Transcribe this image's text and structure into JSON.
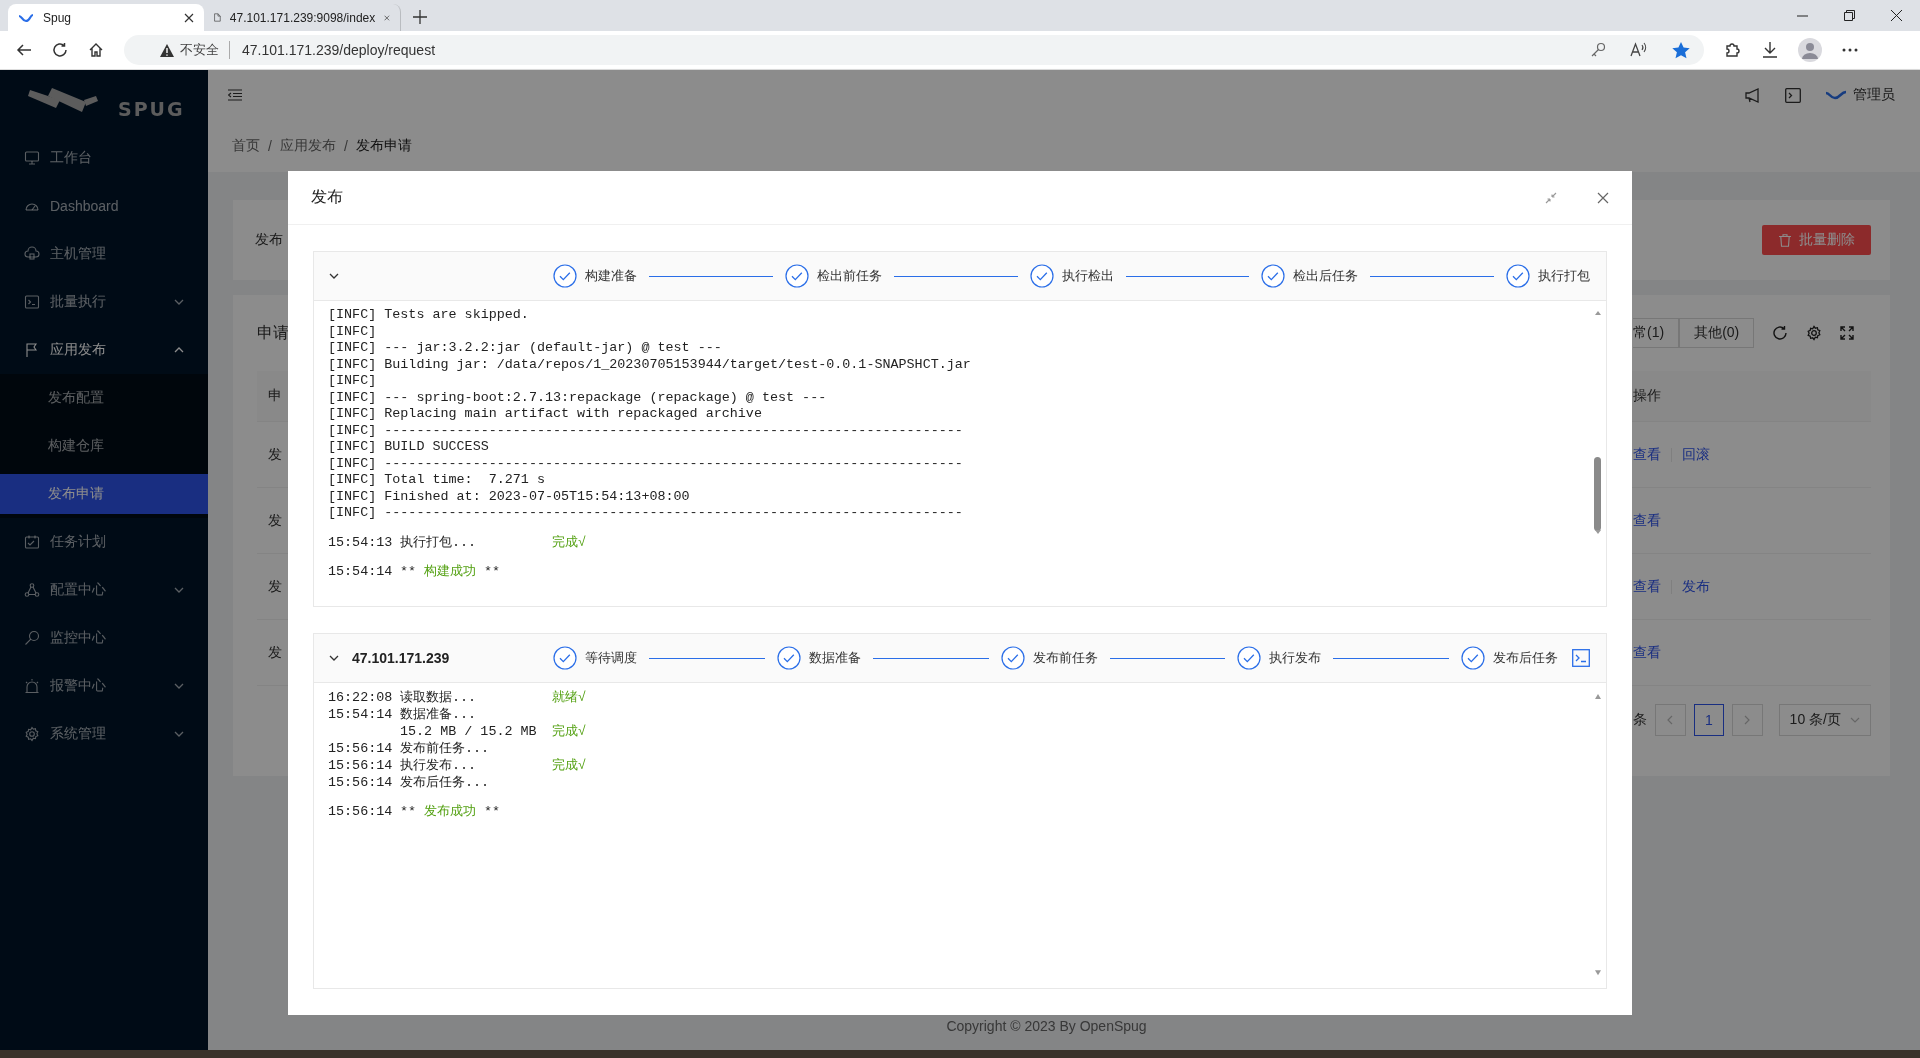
{
  "browser": {
    "tabs": [
      {
        "title": "Spug",
        "selected": true
      },
      {
        "title": "47.101.171.239:9098/index",
        "selected": false
      }
    ],
    "security": "不安全",
    "url": "47.101.171.239/deploy/request"
  },
  "sidebar": {
    "logo_text": "SPUG",
    "items": [
      {
        "label": "工作台",
        "kind": "link",
        "selected": false
      },
      {
        "label": "Dashboard",
        "kind": "link",
        "selected": false
      },
      {
        "label": "主机管理",
        "kind": "link",
        "selected": false
      },
      {
        "label": "批量执行",
        "kind": "group",
        "expanded": false,
        "selected": false
      },
      {
        "label": "应用发布",
        "kind": "group",
        "expanded": true,
        "selected": false,
        "children": [
          {
            "label": "发布配置",
            "selected": false
          },
          {
            "label": "构建仓库",
            "selected": false
          },
          {
            "label": "发布申请",
            "selected": true
          }
        ]
      },
      {
        "label": "任务计划",
        "kind": "link",
        "selected": false
      },
      {
        "label": "配置中心",
        "kind": "group",
        "expanded": false,
        "selected": false
      },
      {
        "label": "监控中心",
        "kind": "link",
        "selected": false
      },
      {
        "label": "报警中心",
        "kind": "group",
        "expanded": false,
        "selected": false
      },
      {
        "label": "系统管理",
        "kind": "group",
        "expanded": false,
        "selected": false
      }
    ]
  },
  "header": {
    "user": "管理员",
    "breadcrumb_separator": "/",
    "breadcrumb": [
      "首页",
      "应用发布",
      "发布申请"
    ]
  },
  "page": {
    "card_label": "发布",
    "batch_delete": "批量删除",
    "list_title": "申请",
    "filter_tabs": [
      "常(1)",
      "其他(0)"
    ],
    "table": {
      "column_1": "申",
      "actions_heading": "操作",
      "rows": [
        {
          "column_1": "发",
          "actions": [
            "查看",
            "回滚"
          ]
        },
        {
          "column_1": "发",
          "actions": [
            "查看"
          ]
        },
        {
          "column_1": "发",
          "actions": [
            "查看",
            "发布"
          ]
        },
        {
          "column_1": "发",
          "actions": [
            "查看"
          ]
        }
      ]
    },
    "pagination": {
      "total_suffix": "条",
      "page": "1",
      "page_size": "10 条/页"
    },
    "footer": "Copyright © 2023 By OpenSpug"
  },
  "modal": {
    "title": "发布",
    "build": {
      "expanded": true,
      "steps": [
        {
          "label": "构建准备",
          "done": true
        },
        {
          "label": "检出前任务",
          "done": true
        },
        {
          "label": "执行检出",
          "done": true
        },
        {
          "label": "检出后任务",
          "done": true
        },
        {
          "label": "执行打包",
          "done": true
        }
      ],
      "log": [
        {
          "kind": "raw",
          "text": "[INFC] Tests are skipped."
        },
        {
          "kind": "raw",
          "text": "[INFC]"
        },
        {
          "kind": "raw",
          "text": "[INFC] --- jar:3.2.2:jar (default-jar) @ test ---"
        },
        {
          "kind": "raw",
          "text": "[INFC] Building jar: /data/repos/1_20230705153944/target/test-0.0.1-SNAPSHCT.jar"
        },
        {
          "kind": "raw",
          "text": "[INFC]"
        },
        {
          "kind": "raw",
          "text": "[INFC] --- spring-boot:2.7.13:repackage (repackage) @ test ---"
        },
        {
          "kind": "raw",
          "text": "[INFC] Replacing main artifact with repackaged archive"
        },
        {
          "kind": "raw",
          "text": "[INFC] ------------------------------------------------------------------------"
        },
        {
          "kind": "raw",
          "text": "[INFC] BUILD SUCCESS"
        },
        {
          "kind": "raw",
          "text": "[INFC] ------------------------------------------------------------------------"
        },
        {
          "kind": "raw",
          "text": "[INFC] Total time:  7.271 s"
        },
        {
          "kind": "raw",
          "text": "[INFC] Finished at: 2023-07-05T15:54:13+08:00"
        },
        {
          "kind": "raw",
          "text": "[INFC] ------------------------------------------------------------------------"
        },
        {
          "kind": "blank"
        },
        {
          "kind": "step",
          "time": "15:54:13",
          "text": "执行打包...",
          "status": "完成√"
        },
        {
          "kind": "blank"
        },
        {
          "kind": "result",
          "time": "15:54:14",
          "prefix": "**",
          "text": "构建成功",
          "suffix": "**"
        }
      ]
    },
    "hosts": [
      {
        "name": "47.101.171.239",
        "expanded": true,
        "steps": [
          {
            "label": "等待调度",
            "done": true
          },
          {
            "label": "数据准备",
            "done": true
          },
          {
            "label": "发布前任务",
            "done": true
          },
          {
            "label": "执行发布",
            "done": true
          },
          {
            "label": "发布后任务",
            "done": true
          }
        ],
        "log": [
          {
            "kind": "step",
            "time": "16:22:08",
            "text": "读取数据...",
            "status": "就绪√"
          },
          {
            "kind": "step",
            "time": "15:54:14",
            "text": "数据准备..."
          },
          {
            "kind": "detail",
            "text": "15.2 MB / 15.2 MB",
            "status": "完成√"
          },
          {
            "kind": "step",
            "time": "15:56:14",
            "text": "发布前任务..."
          },
          {
            "kind": "step",
            "time": "15:56:14",
            "text": "执行发布...",
            "status": "完成√"
          },
          {
            "kind": "step",
            "time": "15:56:14",
            "text": "发布后任务..."
          },
          {
            "kind": "blank"
          },
          {
            "kind": "result",
            "time": "15:56:14",
            "prefix": "**",
            "text": "发布成功",
            "suffix": "**"
          }
        ]
      }
    ]
  }
}
